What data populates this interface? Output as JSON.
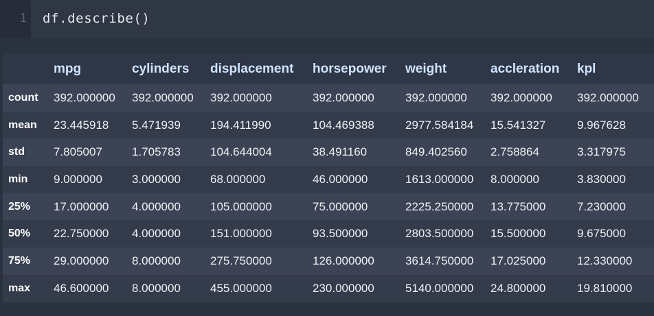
{
  "code_cell": {
    "line_number": "1",
    "code": "df.describe()"
  },
  "table": {
    "index_header": "",
    "columns": [
      "mpg",
      "cylinders",
      "displacement",
      "horsepower",
      "weight",
      "accleration",
      "kpl"
    ],
    "rows": [
      {
        "label": "count",
        "values": [
          "392.000000",
          "392.000000",
          "392.000000",
          "392.000000",
          "392.000000",
          "392.000000",
          "392.000000"
        ]
      },
      {
        "label": "mean",
        "values": [
          "23.445918",
          "5.471939",
          "194.411990",
          "104.469388",
          "2977.584184",
          "15.541327",
          "9.967628"
        ]
      },
      {
        "label": "std",
        "values": [
          "7.805007",
          "1.705783",
          "104.644004",
          "38.491160",
          "849.402560",
          "2.758864",
          "3.317975"
        ]
      },
      {
        "label": "min",
        "values": [
          "9.000000",
          "3.000000",
          "68.000000",
          "46.000000",
          "1613.000000",
          "8.000000",
          "3.830000"
        ]
      },
      {
        "label": "25%",
        "values": [
          "17.000000",
          "4.000000",
          "105.000000",
          "75.000000",
          "2225.250000",
          "13.775000",
          "7.230000"
        ]
      },
      {
        "label": "50%",
        "values": [
          "22.750000",
          "4.000000",
          "151.000000",
          "93.500000",
          "2803.500000",
          "15.500000",
          "9.675000"
        ]
      },
      {
        "label": "75%",
        "values": [
          "29.000000",
          "8.000000",
          "275.750000",
          "126.000000",
          "3614.750000",
          "17.025000",
          "12.330000"
        ]
      },
      {
        "label": "max",
        "values": [
          "46.600000",
          "8.000000",
          "455.000000",
          "230.000000",
          "5140.000000",
          "24.800000",
          "19.810000"
        ]
      }
    ]
  },
  "colors": {
    "background": "#2b323f",
    "code_background": "#2f3644",
    "gutter_background": "#262c38",
    "header_text": "#cfe3ff",
    "row_odd": "#3b4354",
    "row_even": "#343b4b"
  }
}
